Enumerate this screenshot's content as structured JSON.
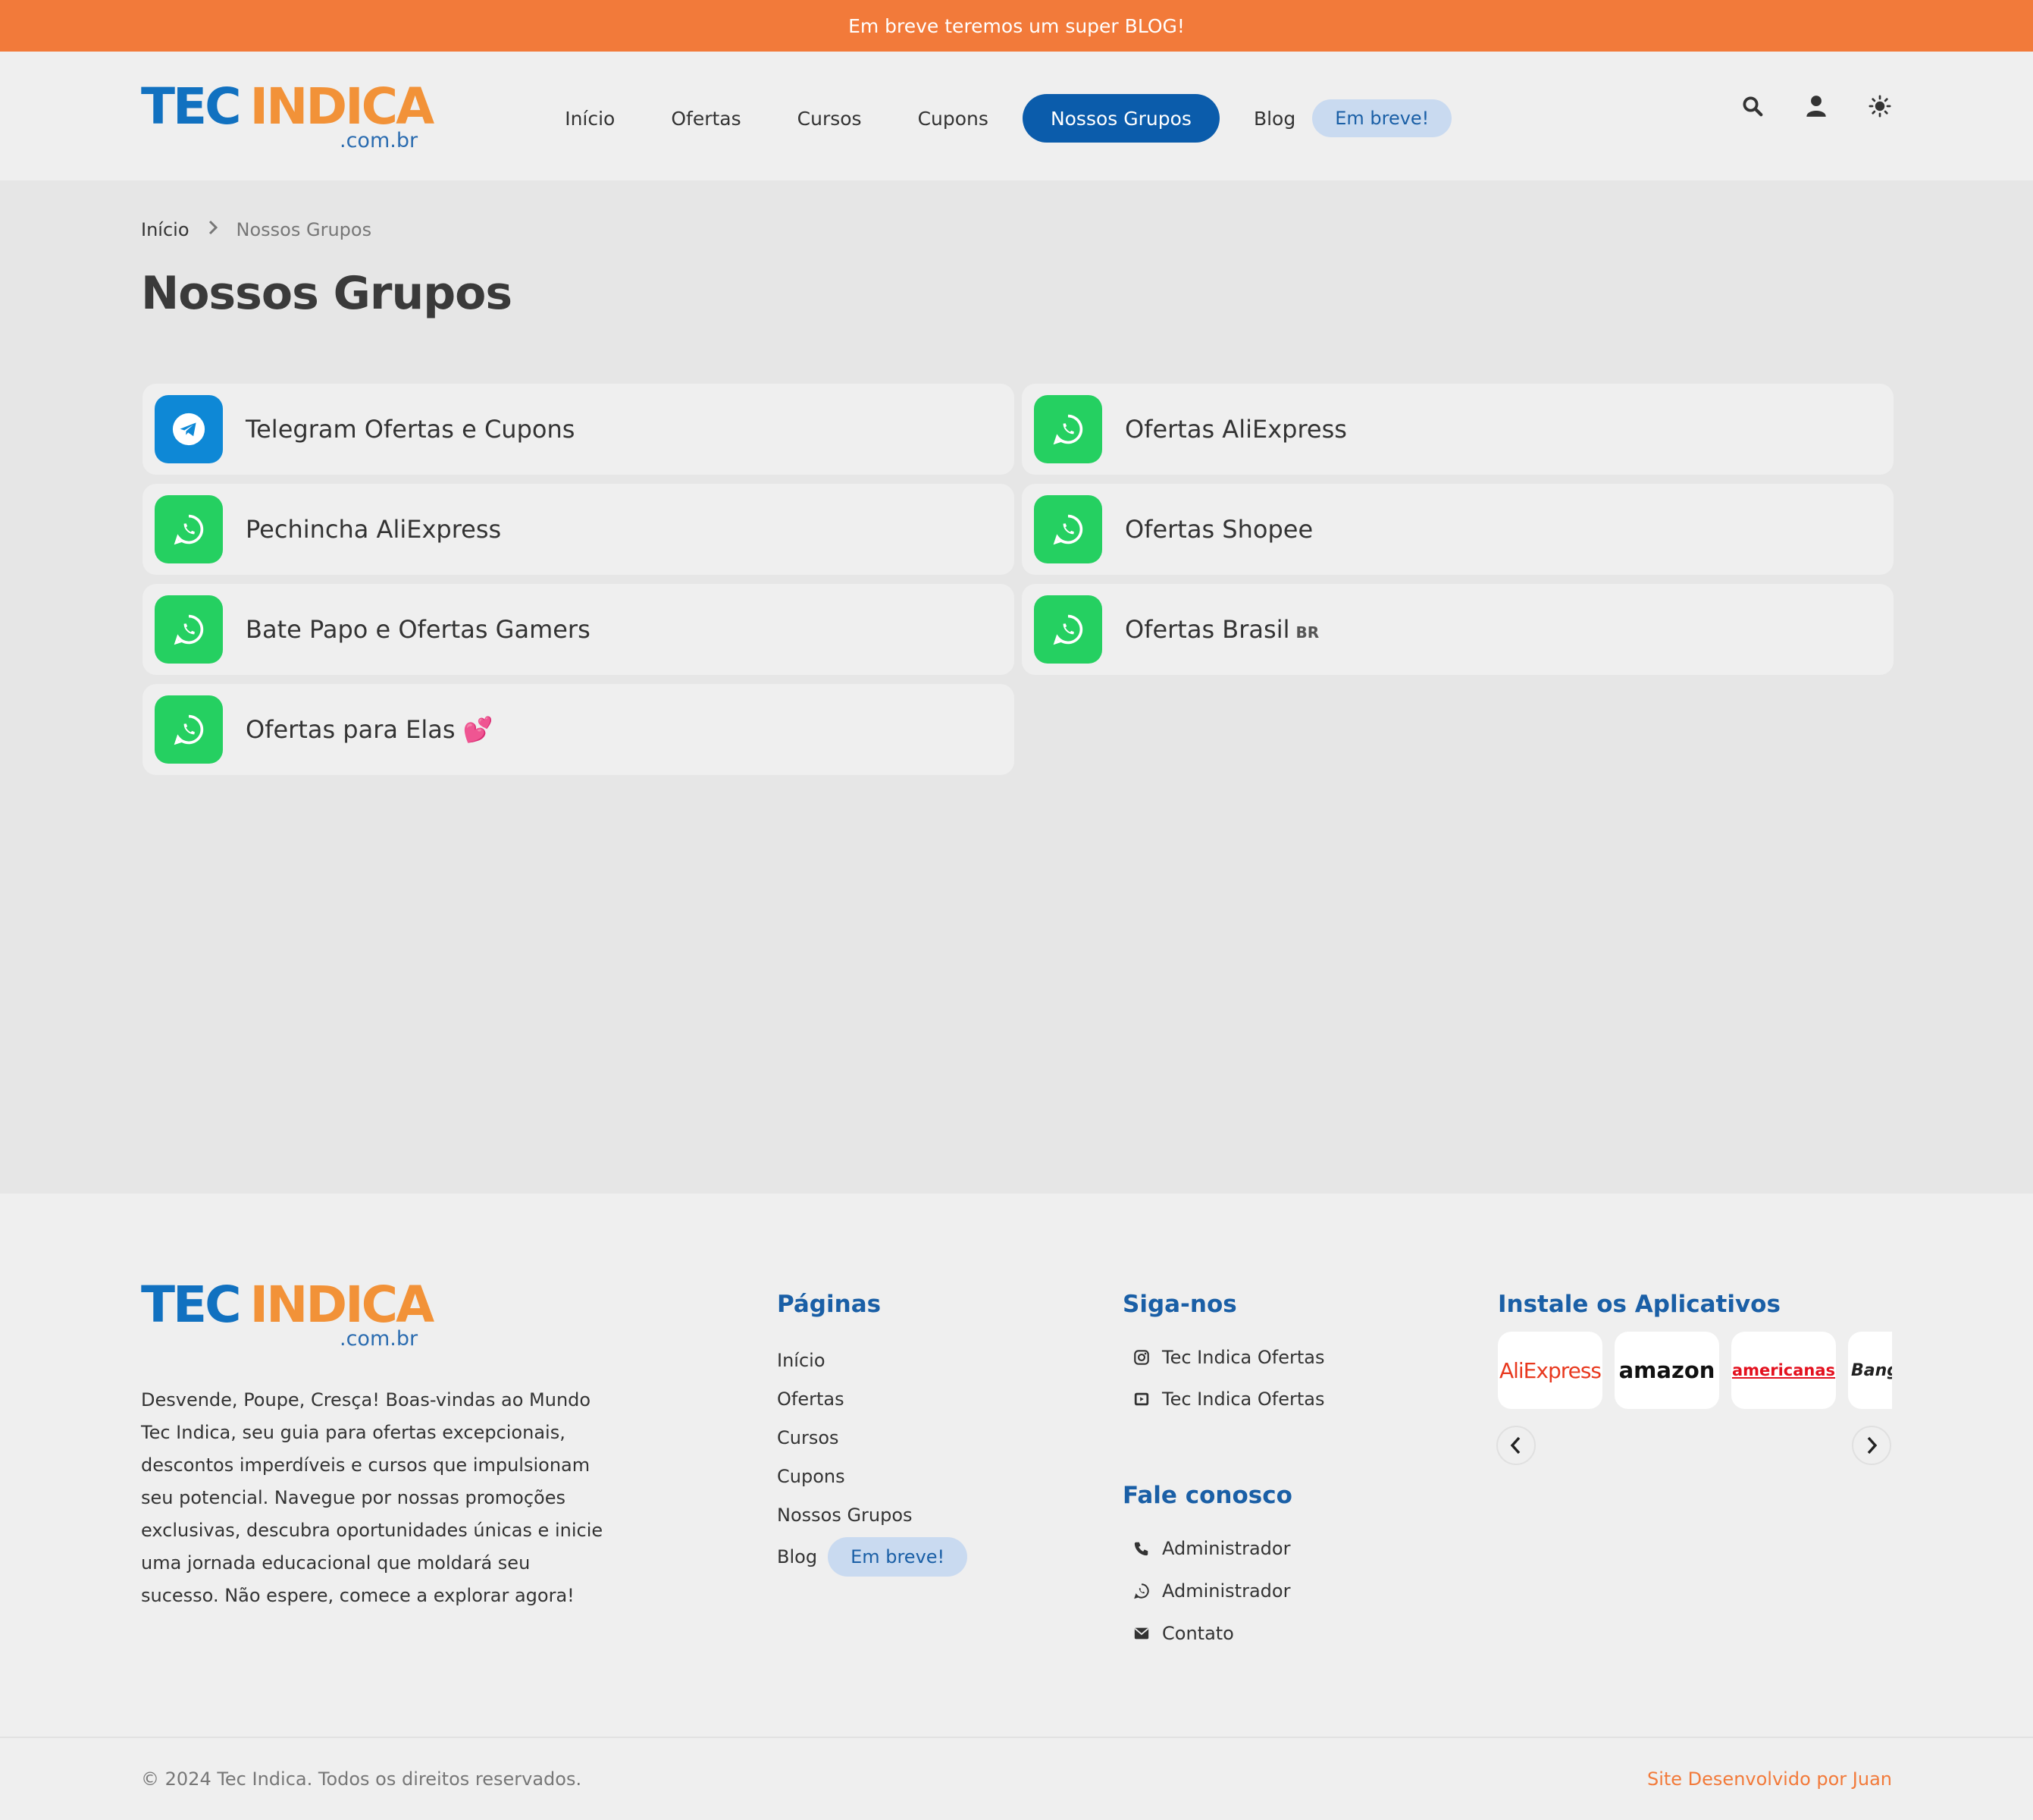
{
  "topbar": {
    "text": "Em breve teremos um super BLOG!"
  },
  "logo": {
    "tec": "TEC",
    "indica": "INDICA",
    "domain": ".com.br"
  },
  "nav": {
    "items": [
      "Início",
      "Ofertas",
      "Cursos",
      "Cupons",
      "Nossos Grupos",
      "Blog"
    ],
    "active": "Nossos Grupos",
    "badge": "Em breve!"
  },
  "header_icons": [
    "search-icon",
    "user-icon",
    "sun-icon"
  ],
  "breadcrumb": {
    "home": "Início",
    "current": "Nossos Grupos"
  },
  "page": {
    "title": "Nossos Grupos"
  },
  "groups": [
    {
      "name": "Telegram Ofertas e Cupons",
      "icon": "telegram-icon"
    },
    {
      "name": "Ofertas AliExpress",
      "icon": "whatsapp-icon"
    },
    {
      "name": "Pechincha AliExpress",
      "icon": "whatsapp-icon"
    },
    {
      "name": "Ofertas Shopee",
      "icon": "whatsapp-icon"
    },
    {
      "name": "Bate Papo e Ofertas Gamers",
      "icon": "whatsapp-icon"
    },
    {
      "name": "Ofertas Brasil",
      "tag": "BR",
      "icon": "whatsapp-icon"
    },
    {
      "name": "Ofertas para Elas",
      "emoji": "💕",
      "icon": "whatsapp-icon"
    }
  ],
  "footer": {
    "description": "Desvende, Poupe, Cresça! Boas-vindas ao Mundo Tec Indica, seu guia para ofertas excepcionais, descontos imperdíveis e cursos que impulsionam seu potencial. Navegue por nossas promoções exclusivas, descubra oportunidades únicas e inicie uma jornada educacional que moldará seu sucesso. Não espere, comece a explorar agora!",
    "pages_title": "Páginas",
    "pages": [
      "Início",
      "Ofertas",
      "Cursos",
      "Cupons",
      "Nossos Grupos",
      "Blog"
    ],
    "pages_badge": "Em breve!",
    "follow_title": "Siga-nos",
    "follow": [
      {
        "label": "Tec Indica Ofertas",
        "icon": "instagram-icon"
      },
      {
        "label": "Tec Indica Ofertas",
        "icon": "youtube-icon"
      }
    ],
    "contact_title": "Fale conosco",
    "contact": [
      {
        "label": "Administrador",
        "icon": "phone-icon"
      },
      {
        "label": "Administrador",
        "icon": "whatsapp-icon"
      },
      {
        "label": "Contato",
        "icon": "mail-icon"
      }
    ],
    "apps_title": "Instale os Aplicativos",
    "apps": [
      "AliExpress",
      "amazon",
      "americanas",
      "Bang"
    ],
    "copyright": "© 2024 Tec Indica. Todos os direitos reservados.",
    "developer": "Site Desenvolvido por Juan"
  },
  "colors": {
    "accent": "#f27a3a",
    "primary": "#0b5cab",
    "whatsapp": "#25d061",
    "telegram": "#0e88d6"
  }
}
